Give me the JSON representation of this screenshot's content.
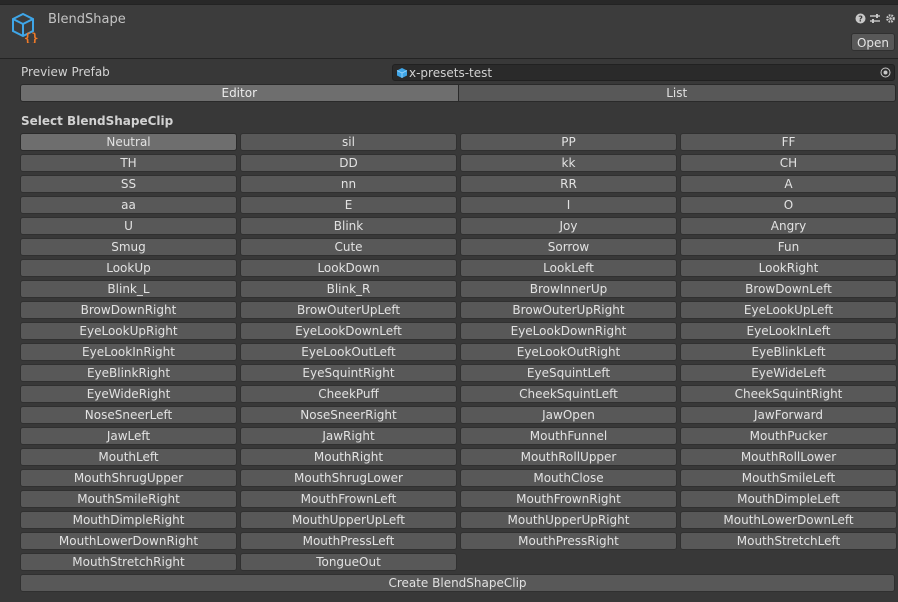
{
  "header": {
    "title": "BlendShape",
    "open_label": "Open"
  },
  "preview": {
    "label": "Preview Prefab",
    "value": "x-presets-test"
  },
  "tabs": [
    {
      "label": "Editor",
      "active": true
    },
    {
      "label": "List",
      "active": false
    }
  ],
  "section_label": "Select BlendShapeClip",
  "selected_clip": "Neutral",
  "clips": [
    "Neutral",
    "sil",
    "PP",
    "FF",
    "TH",
    "DD",
    "kk",
    "CH",
    "SS",
    "nn",
    "RR",
    "A",
    "aa",
    "E",
    "I",
    "O",
    "U",
    "Blink",
    "Joy",
    "Angry",
    "Smug",
    "Cute",
    "Sorrow",
    "Fun",
    "LookUp",
    "LookDown",
    "LookLeft",
    "LookRight",
    "Blink_L",
    "Blink_R",
    "BrowInnerUp",
    "BrowDownLeft",
    "BrowDownRight",
    "BrowOuterUpLeft",
    "BrowOuterUpRight",
    "EyeLookUpLeft",
    "EyeLookUpRight",
    "EyeLookDownLeft",
    "EyeLookDownRight",
    "EyeLookInLeft",
    "EyeLookInRight",
    "EyeLookOutLeft",
    "EyeLookOutRight",
    "EyeBlinkLeft",
    "EyeBlinkRight",
    "EyeSquintRight",
    "EyeSquintLeft",
    "EyeWideLeft",
    "EyeWideRight",
    "CheekPuff",
    "CheekSquintLeft",
    "CheekSquintRight",
    "NoseSneerLeft",
    "NoseSneerRight",
    "JawOpen",
    "JawForward",
    "JawLeft",
    "JawRight",
    "MouthFunnel",
    "MouthPucker",
    "MouthLeft",
    "MouthRight",
    "MouthRollUpper",
    "MouthRollLower",
    "MouthShrugUpper",
    "MouthShrugLower",
    "MouthClose",
    "MouthSmileLeft",
    "MouthSmileRight",
    "MouthFrownLeft",
    "MouthFrownRight",
    "MouthDimpleLeft",
    "MouthDimpleRight",
    "MouthUpperUpLeft",
    "MouthUpperUpRight",
    "MouthLowerDownLeft",
    "MouthLowerDownRight",
    "MouthPressLeft",
    "MouthPressRight",
    "MouthStretchLeft",
    "MouthStretchRight",
    "TongueOut"
  ],
  "create_label": "Create BlendShapeClip",
  "icons": {
    "object": "blendshape-asset-icon",
    "help": "help-icon",
    "preset": "preset-icon",
    "settings": "gear-icon",
    "prefab": "prefab-cube-icon",
    "picker": "object-picker-icon"
  },
  "colors": {
    "background": "#383838",
    "button": "#585858",
    "button_active": "#6e6e6e",
    "icon_blue": "#3fa6e8",
    "icon_orange": "#f07a28"
  }
}
